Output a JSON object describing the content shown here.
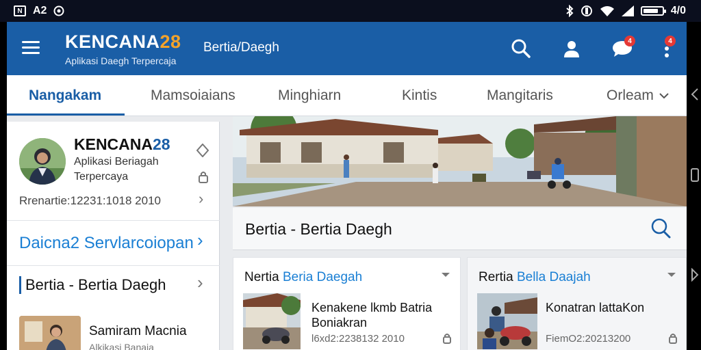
{
  "status_bar": {
    "left_text": "A2",
    "badge": "N",
    "right_text": "4/0",
    "battery_level": 0.8
  },
  "header": {
    "brand_title_text": "KENCANA",
    "brand_title_num": "28",
    "brand_subtitle": "Aplikasi Daegh Terpercaja",
    "page_title": "Bertia/Daegh",
    "notif_count": "4",
    "alert_count": "4"
  },
  "tabs": [
    {
      "label": "Nangakam",
      "active": true
    },
    {
      "label": "Mamsoiaians",
      "active": false
    },
    {
      "label": "Minghiarn",
      "active": false
    },
    {
      "label": "Kintis",
      "active": false
    },
    {
      "label": "Mangitaris",
      "active": false
    },
    {
      "label": "Orleam",
      "active": false
    }
  ],
  "sidebar": {
    "profile_name_text": "KENCANA",
    "profile_name_num": "28",
    "profile_desc": "Aplikasi Beriagah Terpercaya",
    "reference": "Rrenartie:12231:1018 2010",
    "link": "Daicna2 Servlarcoiopan",
    "section": "Bertia - Bertia Daegh",
    "item_title": "Samiram Macnia",
    "item_sub": "Alkikasi Banaia"
  },
  "main": {
    "search_label": "Bertia - Bertia Daegh",
    "cards": [
      {
        "head_prefix": "Nertia ",
        "head_highlight": "Beria Daegah",
        "title_line1": "Kenakene lkmb Batria",
        "title_line2": "Boniakran",
        "meta": "l6xd2:2238132 2010"
      },
      {
        "head_prefix": "Rertia ",
        "head_highlight": "Bella Daajah",
        "title_line1": "Konatran lattaKon",
        "title_line2": "",
        "meta": "FiemO2:20213200"
      }
    ]
  },
  "colors": {
    "primary": "#1a5ea6",
    "accent": "#f3a32a",
    "link": "#1a7fd4",
    "badge": "#e53935"
  }
}
